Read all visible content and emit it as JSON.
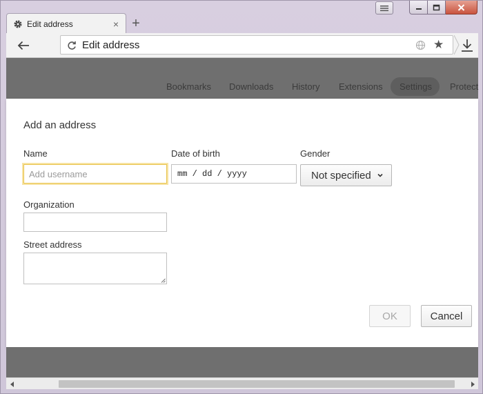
{
  "window": {
    "tab_title": "Edit address",
    "tab_close": "×",
    "new_tab": "+"
  },
  "toolbar": {
    "omnibox_text": "Edit address"
  },
  "settings_nav": {
    "items": [
      "Bookmarks",
      "Downloads",
      "History",
      "Extensions",
      "Settings",
      "Protect"
    ],
    "active": "Settings"
  },
  "dialog": {
    "title": "Add an address",
    "name_label": "Name",
    "name_placeholder": "Add username",
    "dob_label": "Date of birth",
    "dob_value": "mm / dd / yyyy",
    "gender_label": "Gender",
    "gender_value": "Not specified",
    "organization_label": "Organization",
    "street_label": "Street address",
    "ok_label": "OK",
    "cancel_label": "Cancel"
  },
  "colors": {
    "focus_ring": "#e8c34a",
    "overlay": "#6f6f6f",
    "window_frame": "#d8cfe0",
    "close_button": "#c9543f"
  }
}
